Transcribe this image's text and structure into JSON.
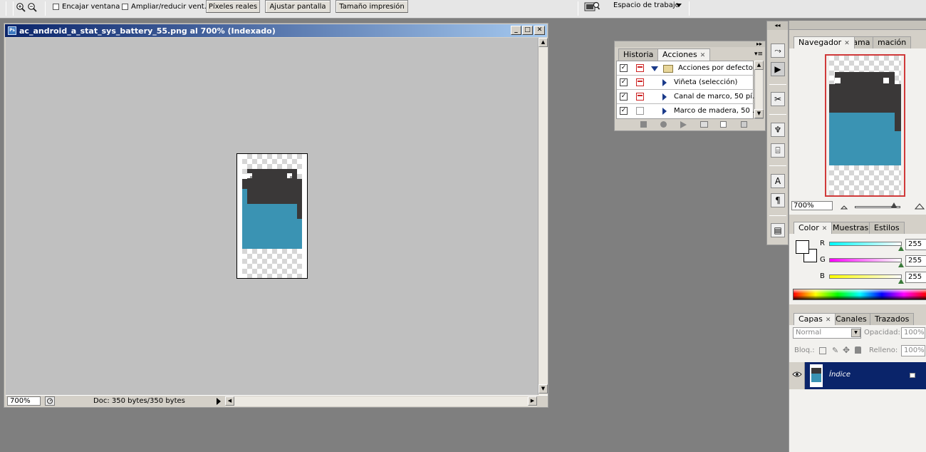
{
  "options_bar": {
    "fit_window_label": "Encajar ventana",
    "resize_windows_label": "Ampliar/reducir vent.",
    "actual_pixels_label": "Píxeles reales",
    "fit_screen_label": "Ajustar pantalla",
    "print_size_label": "Tamaño impresión",
    "workspace_label": "Espacio de trabajo"
  },
  "document": {
    "title": "ac_android_a_stat_sys_battery_55.png al 700% (Indexado)",
    "app_badge": "Ps",
    "zoom": "700%",
    "doc_info": "Doc: 350 bytes/350 bytes"
  },
  "actions_panel": {
    "tabs": [
      "Historia",
      "Acciones"
    ],
    "rows": [
      "Acciones por defecto",
      "Viñeta (selección)",
      "Canal de marco, 50 pí...",
      "Marco de madera, 50 ..."
    ]
  },
  "navigator_panel": {
    "tabs": [
      "Navegador",
      "ograma",
      "mación"
    ],
    "zoom": "700%"
  },
  "color_panel": {
    "tabs": [
      "Color",
      "Muestras",
      "Estilos"
    ],
    "channels": [
      {
        "label": "R",
        "value": "255"
      },
      {
        "label": "G",
        "value": "255"
      },
      {
        "label": "B",
        "value": "255"
      }
    ]
  },
  "layers_panel": {
    "tabs": [
      "Capas",
      "Canales",
      "Trazados"
    ],
    "blend_mode": "Normal",
    "opacity_label": "Opacidad:",
    "opacity_value": "100%",
    "lock_label": "Bloq.:",
    "fill_label": "Relleno:",
    "fill_value": "100%",
    "layer_name": "Índice"
  },
  "colors": {
    "battery_dark": "#3a3838",
    "battery_teal": "#3a93b3",
    "title_gradient_start": "#0a246a",
    "selected_layer": "#0a246a"
  }
}
